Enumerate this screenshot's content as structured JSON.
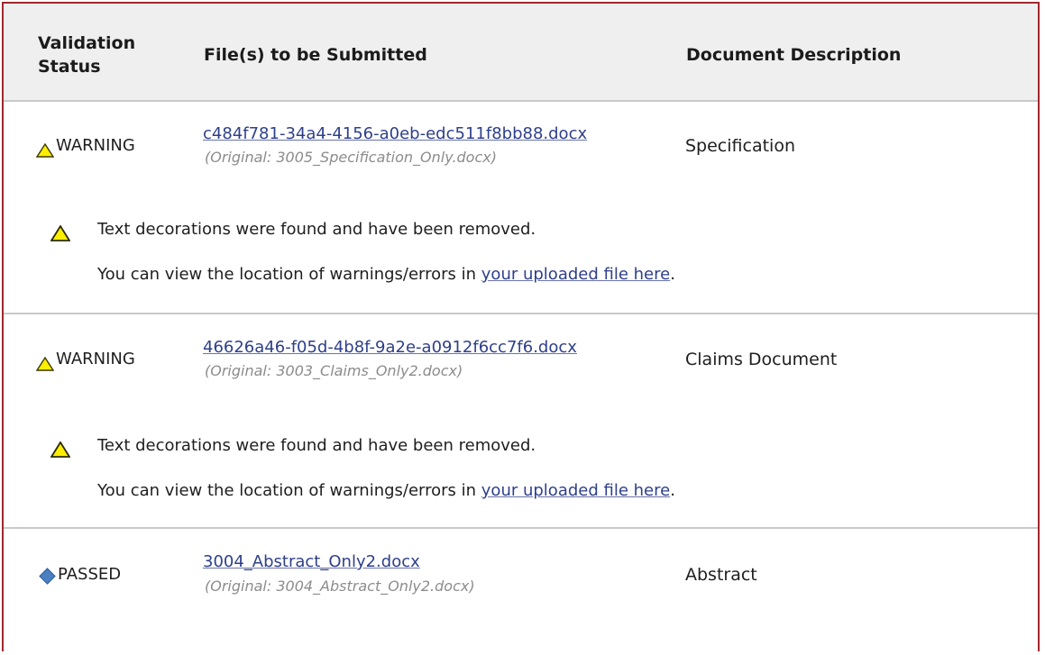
{
  "header": {
    "status": "Validation Status",
    "files": "File(s) to be Submitted",
    "description": "Document Description"
  },
  "rows": [
    {
      "status": "WARNING",
      "status_icon": "warning-triangle-icon",
      "file_name": "c484f781-34a4-4156-a0eb-edc511f8bb88.docx",
      "original": "(Original: 3005_Specification_Only.docx)",
      "description": "Specification",
      "message": "Text decorations were found and have been removed.",
      "view_prefix": "You can view the location of warnings/errors in ",
      "view_link": "your uploaded file here",
      "view_suffix": "."
    },
    {
      "status": "WARNING",
      "status_icon": "warning-triangle-icon",
      "file_name": "46626a46-f05d-4b8f-9a2e-a0912f6cc7f6.docx",
      "original": "(Original: 3003_Claims_Only2.docx)",
      "description": "Claims Document",
      "message": "Text decorations were found and have been removed.",
      "view_prefix": "You can view the location of warnings/errors in ",
      "view_link": "your uploaded file here",
      "view_suffix": "."
    },
    {
      "status": "PASSED",
      "status_icon": "passed-diamond-icon",
      "file_name": "3004_Abstract_Only2.docx",
      "original": "(Original: 3004_Abstract_Only2.docx)",
      "description": "Abstract"
    }
  ],
  "colors": {
    "frame_border": "#a0282e",
    "header_bg": "#efefef",
    "link": "#2e3f8a",
    "warning_fill": "#ffee00",
    "passed_fill": "#4a7fc1"
  }
}
